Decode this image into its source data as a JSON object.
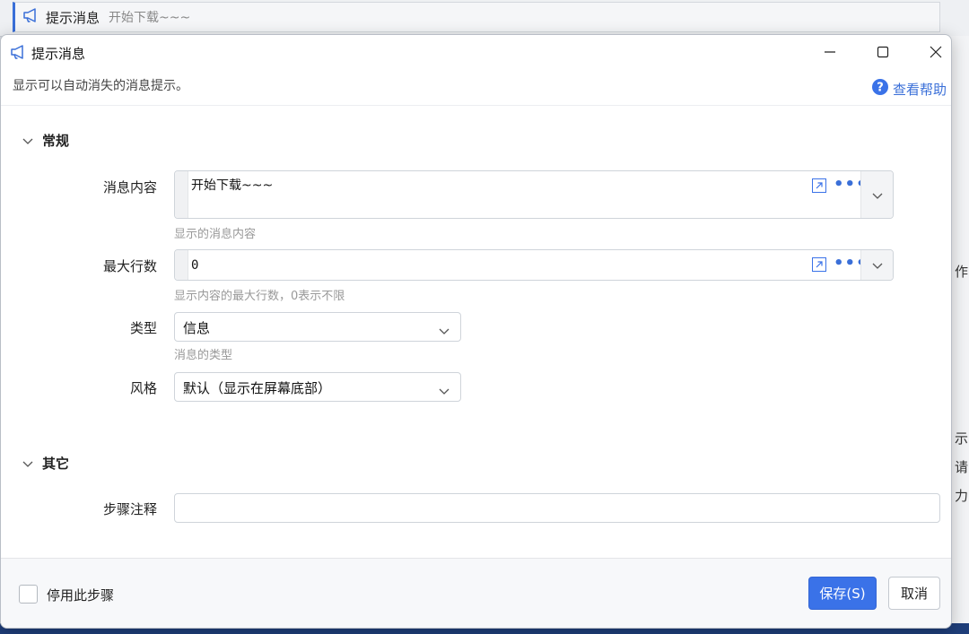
{
  "background": {
    "step_title": "提示消息",
    "step_subtitle": "开始下载~~~",
    "right_glyphs": [
      "作",
      "示",
      "请",
      "力"
    ]
  },
  "window": {
    "title": "提示消息",
    "description": "显示可以自动消失的消息提示。",
    "help_label": "查看帮助",
    "accent_color": "#3a72e8"
  },
  "sections": {
    "general": {
      "title": "常规",
      "fields": {
        "message": {
          "label": "消息内容",
          "value": "开始下载~~~",
          "hint": "显示的消息内容"
        },
        "max_lines": {
          "label": "最大行数",
          "value": "0",
          "hint": "显示内容的最大行数，0表示不限"
        },
        "type": {
          "label": "类型",
          "value": "信息",
          "hint": "消息的类型"
        },
        "style": {
          "label": "风格",
          "value": "默认（显示在屏幕底部）"
        }
      }
    },
    "other": {
      "title": "其它",
      "fields": {
        "note": {
          "label": "步骤注释",
          "value": ""
        }
      }
    }
  },
  "footer": {
    "disable_label": "停用此步骤",
    "save_label": "保存(S)",
    "cancel_label": "取消"
  }
}
